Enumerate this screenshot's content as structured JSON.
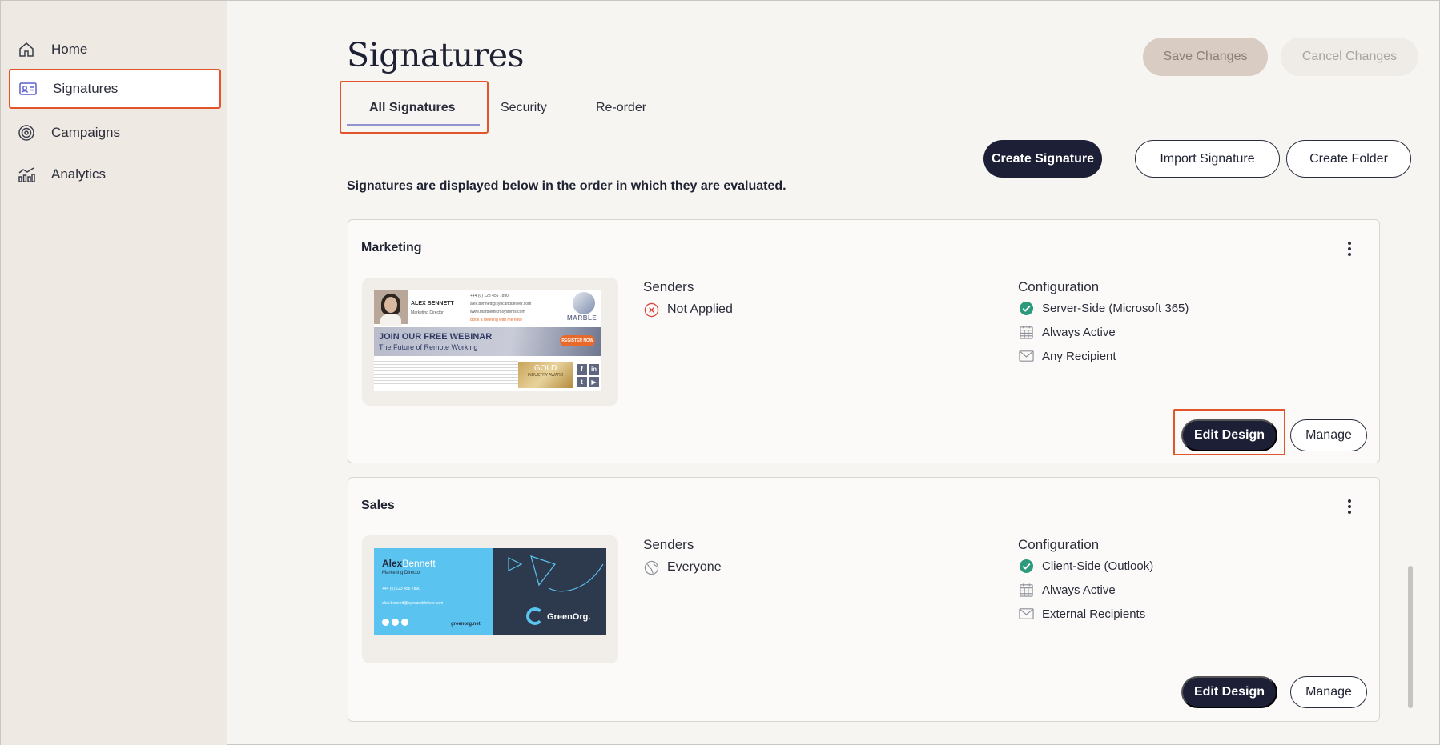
{
  "sidebar": {
    "items": [
      {
        "label": "Home",
        "icon": "home-icon"
      },
      {
        "label": "Signatures",
        "icon": "id-card-icon",
        "active": true
      },
      {
        "label": "Campaigns",
        "icon": "target-icon"
      },
      {
        "label": "Analytics",
        "icon": "bar-chart-icon"
      }
    ]
  },
  "header": {
    "title": "Signatures",
    "save_label": "Save Changes",
    "cancel_label": "Cancel Changes"
  },
  "tabs": [
    {
      "label": "All Signatures",
      "active": true
    },
    {
      "label": "Security"
    },
    {
      "label": "Re-order"
    }
  ],
  "toolbar": {
    "create_signature": "Create Signature",
    "import_signature": "Import Signature",
    "create_folder": "Create Folder"
  },
  "order_note": "Signatures are displayed below in the order in which they are evaluated.",
  "colors": {
    "accent": "#1c1f35",
    "highlight": "#e2552a",
    "success": "#2e9a7c",
    "error": "#d6453d",
    "sidebar_bg": "#efe9e3"
  },
  "cards": [
    {
      "title": "Marketing",
      "senders_label": "Senders",
      "senders_value": "Not Applied",
      "senders_icon": "x-circle-icon",
      "config_label": "Configuration",
      "config": [
        {
          "icon": "check-circle-icon",
          "text": "Server-Side (Microsoft 365)"
        },
        {
          "icon": "calendar-icon",
          "text": "Always Active"
        },
        {
          "icon": "envelope-icon",
          "text": "Any Recipient"
        }
      ],
      "edit_label": "Edit Design",
      "manage_label": "Manage",
      "preview": {
        "name": "ALEX BENNETT",
        "role": "Marketing Director",
        "phone": "+44 (0) 123 456 7890",
        "email": "alex.bennett@syncanddeliver.com",
        "web": "www.marblemicrosystems.com",
        "meeting": "Book a meeting with me now!",
        "logo": "MARBLE",
        "banner_title": "JOIN OUR FREE WEBINAR",
        "banner_sub": "The Future of Remote Working",
        "cta": "REGISTER NOW",
        "award_title": "GOLD",
        "award_sub": "INDUSTRY AWARD"
      }
    },
    {
      "title": "Sales",
      "senders_label": "Senders",
      "senders_value": "Everyone",
      "senders_icon": "globe-icon",
      "config_label": "Configuration",
      "config": [
        {
          "icon": "check-circle-icon",
          "text": "Client-Side (Outlook)"
        },
        {
          "icon": "calendar-icon",
          "text": "Always Active"
        },
        {
          "icon": "envelope-icon",
          "text": "External Recipients"
        }
      ],
      "edit_label": "Edit Design",
      "manage_label": "Manage",
      "preview": {
        "first_name": "Alex",
        "last_name": "Bennett",
        "role": "Marketing Director",
        "phone": "+44 (0) 123 456 7890",
        "email": "alex.bennett@syncanddeliver.com",
        "web": "greenorg.net",
        "logo": "GreenOrg."
      }
    }
  ]
}
